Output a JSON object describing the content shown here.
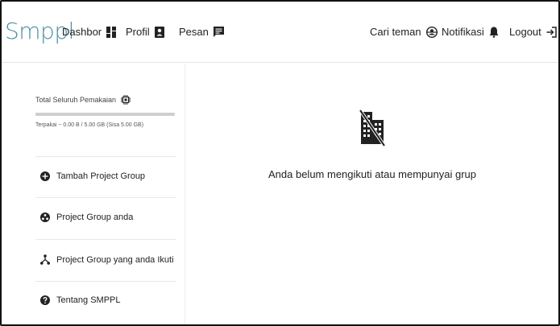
{
  "brand": "Smppl",
  "nav": {
    "dashboard": {
      "label": "Dashbor",
      "icon": "dashboard-icon"
    },
    "profile": {
      "label": "Profil",
      "icon": "profile-icon"
    },
    "messages": {
      "label": "Pesan",
      "icon": "message-icon"
    },
    "find_friends": {
      "label": "Cari teman",
      "icon": "find-friends-icon"
    },
    "notifications": {
      "label": "Notifikasi",
      "icon": "bell-icon"
    },
    "logout": {
      "label": "Logout",
      "icon": "logout-icon"
    }
  },
  "sidebar": {
    "usage": {
      "title": "Total Seluruh Pemakaian",
      "icon": "chip-icon",
      "used_fraction": 0.0,
      "text": "Terpakai ~ 0.00 B / 5.00 GB (Sisa 5.00 GB)"
    },
    "items": [
      {
        "label": "Tambah Project Group",
        "icon": "add-circle-icon"
      },
      {
        "label": "Project Group anda",
        "icon": "group-icon"
      },
      {
        "label": "Project Group yang anda Ikuti",
        "icon": "network-icon"
      },
      {
        "label": "Tentang SMPPL",
        "icon": "help-icon"
      }
    ]
  },
  "main": {
    "empty_icon": "domain-disabled-icon",
    "empty_message": "Anda belum mengikuti atau mempunyai grup"
  },
  "colors": {
    "brand": "#4a8fa3",
    "progress_track": "#cfcfcf",
    "text": "#222222"
  }
}
